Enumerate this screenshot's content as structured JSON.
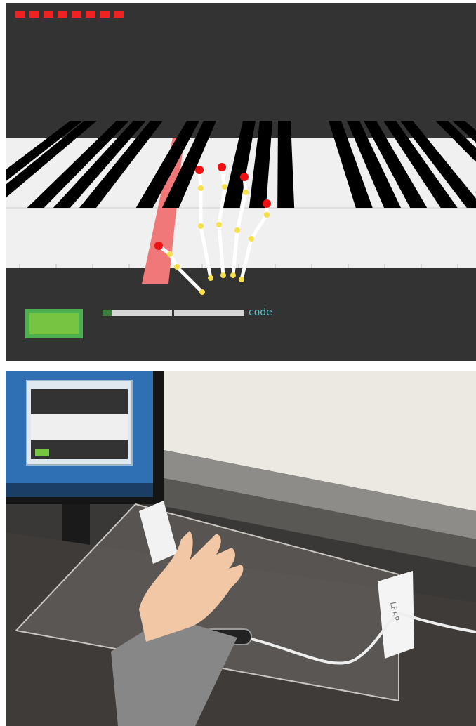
{
  "game": {
    "lives": {
      "count": 8,
      "color": "#ee2222"
    },
    "keyboard": {
      "white_key_color": "#f0f0f0",
      "black_key_color": "#000000",
      "highlight_color": "#f07878"
    },
    "hand": {
      "bone_color": "#ffffff",
      "joint_color": "#f5e04a",
      "fingertip_color": "#ee1111"
    },
    "start_button": {
      "color": "#76c442"
    },
    "progress": {
      "value": 0.065,
      "segments": 2,
      "fill_color": "#3a7d3a",
      "label": "code",
      "label_color": "#5bc0c4"
    }
  },
  "photo": {
    "wall_color": "#ece8e2",
    "desk_color": "#3e3b38",
    "device_label": "LEAP"
  }
}
